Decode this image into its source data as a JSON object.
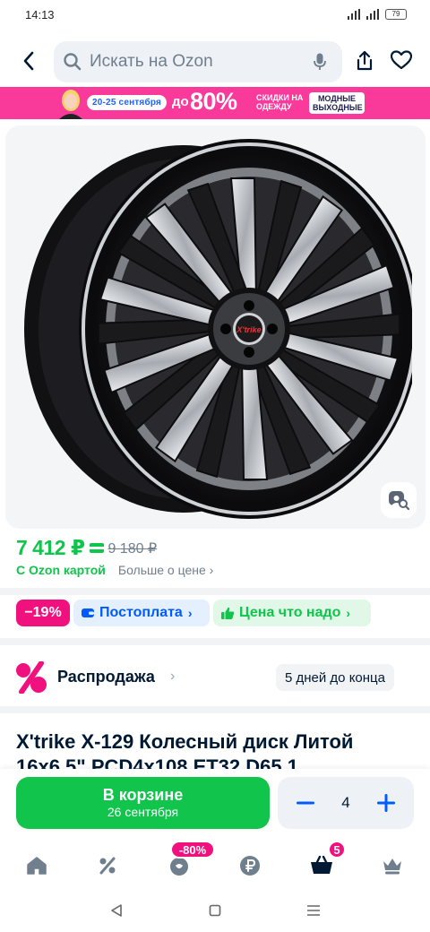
{
  "status_bar": {
    "time": "14:13",
    "battery": "79"
  },
  "search": {
    "placeholder": "Искать на Ozon"
  },
  "icons": {
    "back": "arrow-left-icon",
    "search": "search-icon",
    "mic": "microphone-icon",
    "share": "share-icon",
    "favorite": "heart-icon",
    "similar": "image-search-icon"
  },
  "banner": {
    "dates": "20-25 сентября",
    "upto": "до",
    "percent": "80%",
    "subtitle": "СКИДКИ НА ОДЕЖДУ",
    "tag": "МОДНЫЕ ВЫХОДНЫЕ"
  },
  "product_image": {
    "logo_text": "X'trike"
  },
  "price": {
    "current": "7 412 ₽",
    "old": "9 180 ₽",
    "card_label": "С Ozon картой",
    "more_label": "Больше о цене ›"
  },
  "chips": {
    "discount": "−19%",
    "postpay": "Постоплата",
    "fair_price": "Цена что надо"
  },
  "sale": {
    "title": "Распродажа",
    "timer": "5 дней до конца"
  },
  "product": {
    "title": "X'trike X-129 Колесный диск Литой 16x6.5\" PCD4x108 ET32 D65.1"
  },
  "cart": {
    "button_label": "В корзине",
    "button_sub": "26 сентября",
    "quantity": "4"
  },
  "bottom_nav": {
    "items": [
      "home-icon",
      "percent-icon",
      "fresh-icon",
      "ruble-icon",
      "cart-icon",
      "crown-icon"
    ],
    "sale_badge": "-80%",
    "cart_badge": "5"
  },
  "colors": {
    "ozon_green": "#10c44c",
    "ozon_blue": "#005bff",
    "sale_pink": "#f1117e",
    "banner_pink": "#fa3a9b"
  }
}
